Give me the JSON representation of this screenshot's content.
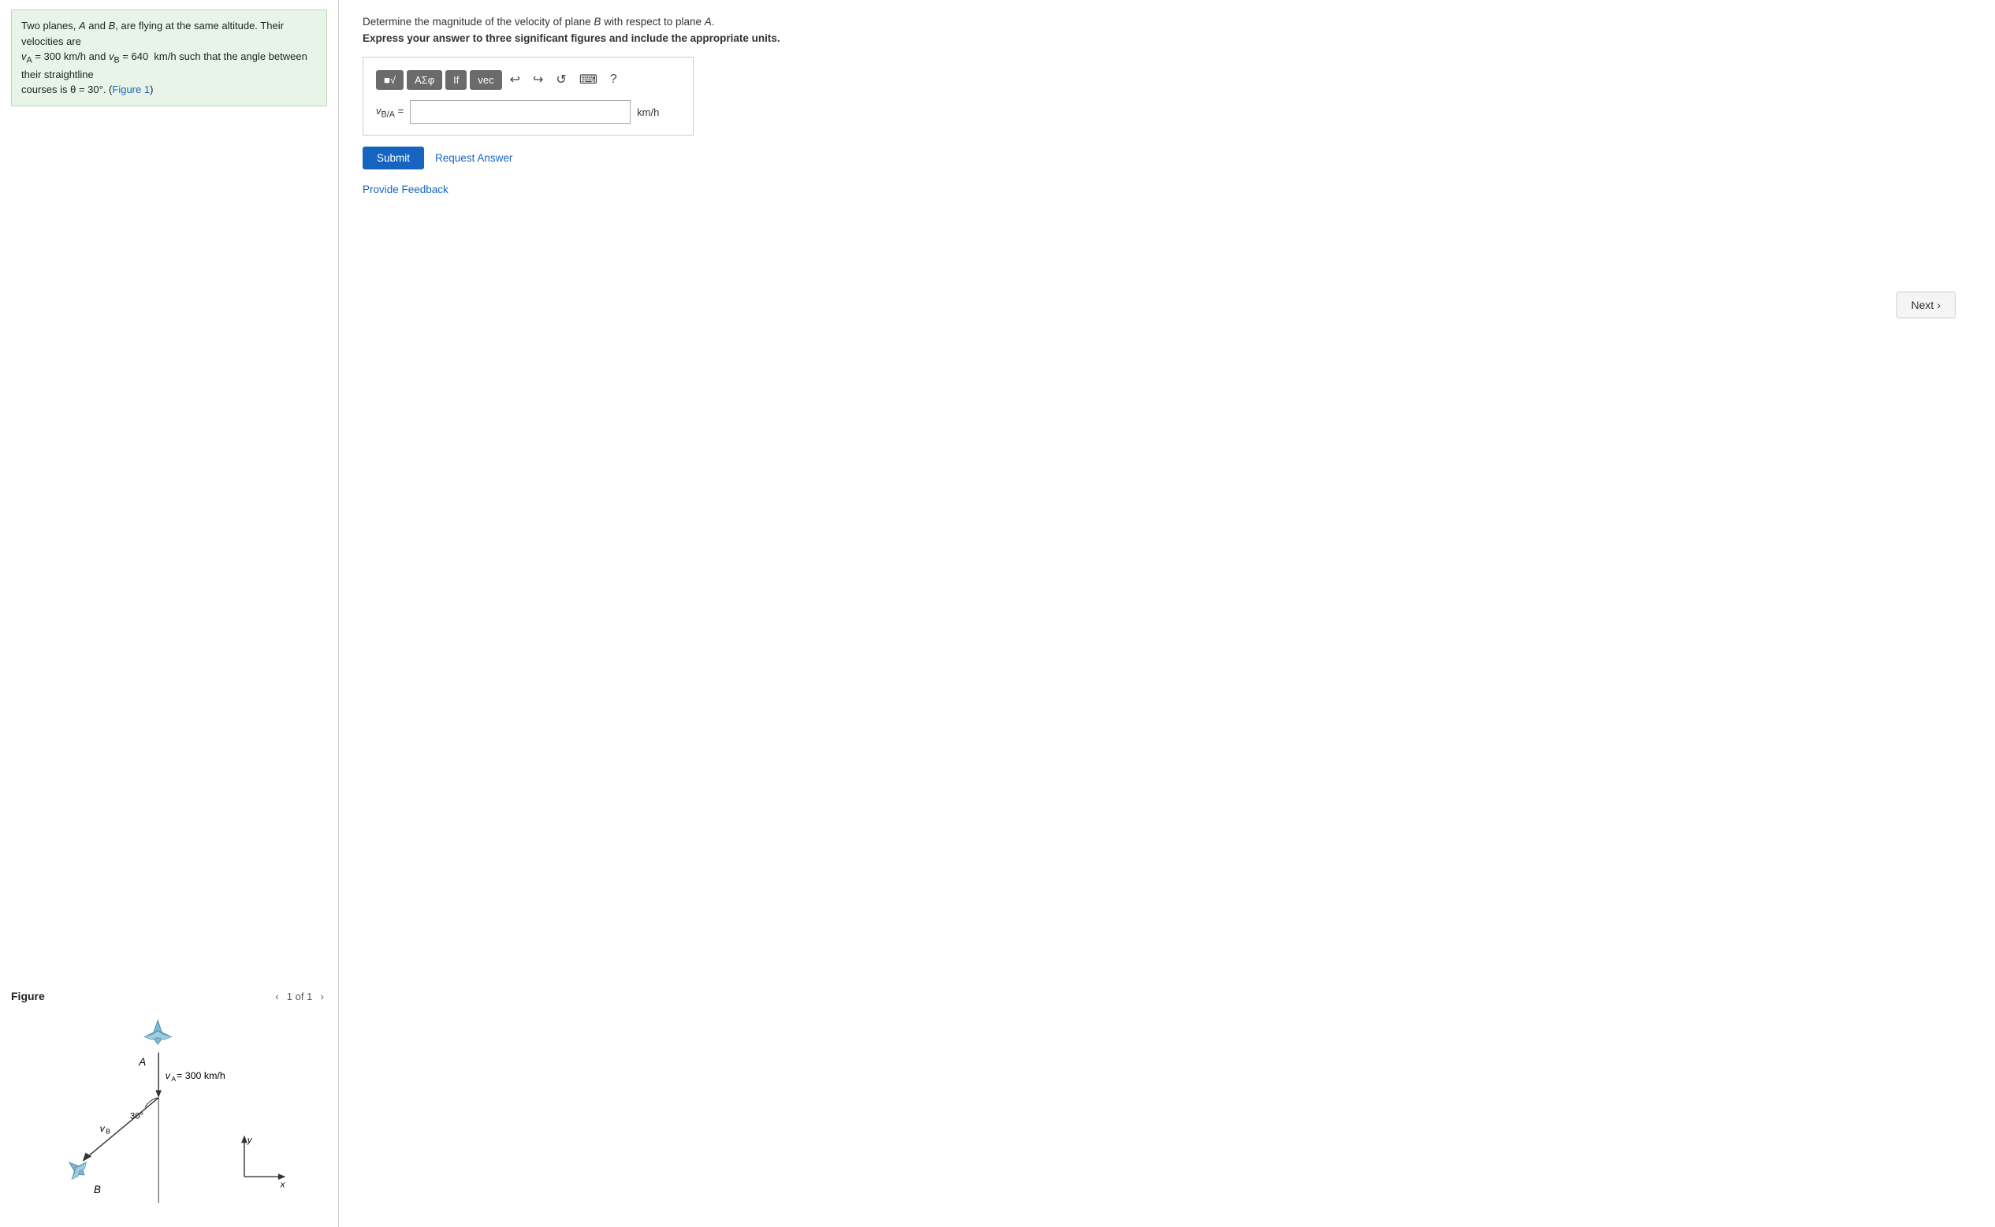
{
  "left_panel": {
    "problem_text_line1": "Two planes, A and B, are flying at the same altitude. Their velocities are",
    "problem_text_line2": "v",
    "problem_text_sub_A": "A",
    "problem_text_line3": " = 300 km/h and v",
    "problem_text_sub_B": "B",
    "problem_text_line4": " = 640  km/h such that the angle between their straightline",
    "problem_text_line5": "courses is θ = 30°. (Figure 1)"
  },
  "figure": {
    "title": "Figure",
    "pagination": "1 of 1",
    "vA_label": "v",
    "vA_sub": "A",
    "vA_value": "= 300 km/h",
    "vB_label": "v",
    "vB_sub": "B",
    "A_label": "A",
    "B_label": "B",
    "angle_label": "30°",
    "y_label": "y",
    "x_label": "x"
  },
  "right_panel": {
    "instruction_part1": "Determine the magnitude of the velocity of plane ",
    "instruction_B": "B",
    "instruction_part2": " with respect to plane ",
    "instruction_A": "A",
    "instruction_end": ".",
    "emphasis": "Express your answer to three significant figures and include the appropriate units.",
    "toolbar": {
      "btn1": "√",
      "btn2": "ΑΣφ",
      "btn3": "If",
      "btn4": "vec",
      "undo_label": "undo",
      "redo_label": "redo",
      "reset_label": "reset",
      "keyboard_label": "keyboard",
      "help_label": "?"
    },
    "answer_label": "v",
    "answer_sub": "B/A",
    "answer_equals": "=",
    "answer_unit": "km/h",
    "submit_label": "Submit",
    "request_answer_label": "Request Answer",
    "feedback_label": "Provide Feedback"
  },
  "next_button": {
    "label": "Next",
    "chevron": "›"
  }
}
